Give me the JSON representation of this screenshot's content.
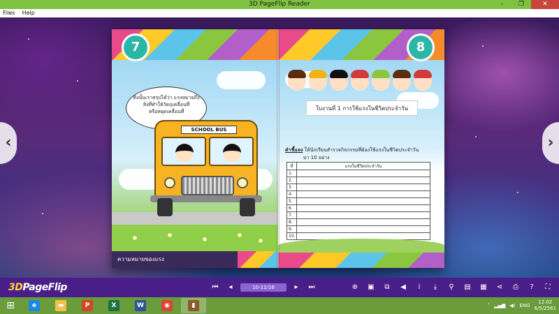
{
  "window": {
    "title": "3D PageFlip Reader",
    "minimize": "–",
    "maximize": "❐",
    "close": "✕"
  },
  "menu": [
    "Files",
    "Help"
  ],
  "navigation": {
    "prev_arrow": "‹",
    "next_arrow": "›"
  },
  "book": {
    "left_page": {
      "page_number": "7",
      "bubble_lines": [
        "ดังนั้นเราสรุปได้ว่า  แรงหมายถึง",
        "สิ่งที่ทำให้วัตถุเคลื่อนที่",
        "หรือหยุดเคลื่อนที่"
      ],
      "bus_sign": "SCHOOL BUS",
      "footer_text": "ความหมายของแรง"
    },
    "right_page": {
      "page_number": "8",
      "worksheet_title": "ใบงานที่ 1 การใช้แรงในชีวิตประจำวัน",
      "instruction_label": "คำชี้แจง",
      "instruction_text": "ให้นักเรียนสำรวจกิจกรรมที่ต้องใช้แรงในชีวิตประจำวัน",
      "instruction_text2": "มา 10 อย่าง",
      "table_headers": [
        "ที่",
        "แรงในชีวิตประจำวัน"
      ],
      "table_rows": [
        "1.",
        "2.",
        "3.",
        "4.",
        "5.",
        "6.",
        "7.",
        "8.",
        "9.",
        "10."
      ]
    }
  },
  "toolbar": {
    "logo_prefix": "3D",
    "logo_suffix": "PageFlip",
    "first": "⏮",
    "prev": "◂",
    "page_indicator": "10-11/16",
    "next": "▸",
    "last": "⏭",
    "tools": [
      "⊕",
      "▣",
      "⧉",
      "◀",
      "i",
      "⤓",
      "⚲",
      "▤",
      "▦",
      "⋖",
      "⎙",
      "?",
      "⛶"
    ]
  },
  "taskbar": {
    "apps": [
      {
        "name": "internet-explorer",
        "glyph": "e",
        "color": "#1e88e5"
      },
      {
        "name": "file-explorer",
        "glyph": "▬",
        "color": "#f2c14e"
      },
      {
        "name": "powerpoint",
        "glyph": "P",
        "color": "#d24726"
      },
      {
        "name": "excel",
        "glyph": "X",
        "color": "#1e7145"
      },
      {
        "name": "word",
        "glyph": "W",
        "color": "#2b579a"
      },
      {
        "name": "chrome",
        "glyph": "◉",
        "color": "#db4437"
      },
      {
        "name": "pageflip-reader",
        "glyph": "▮",
        "color": "#8b5a2b"
      }
    ],
    "language": "ENG",
    "time": "12:02",
    "date": "6/5/2561"
  }
}
